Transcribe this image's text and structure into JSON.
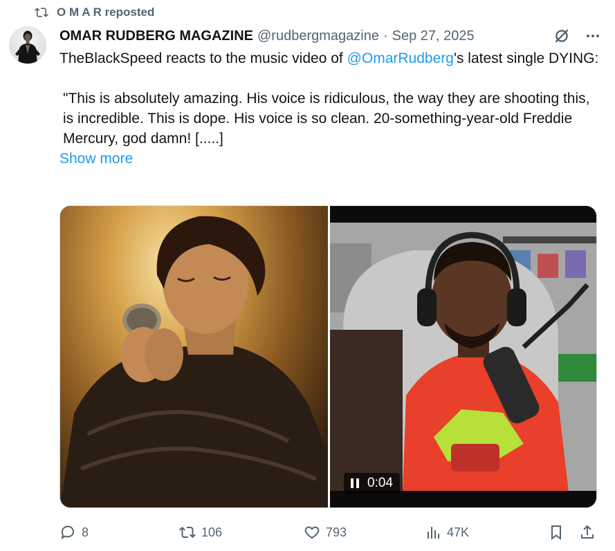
{
  "repost": {
    "text": "O M A R reposted",
    "icon": "repost-icon"
  },
  "author": {
    "name": "OMAR RUDBERG MAGAZINE",
    "handle": "@rudbergmagazine",
    "separator": "·",
    "date": "Sep 27, 2025"
  },
  "header_icons": [
    "grok-icon",
    "more-icon"
  ],
  "post": {
    "line1_before": "TheBlackSpeed reacts to the music video of ",
    "mention": "@OmarRudberg",
    "line1_after": "'s latest single DYING:",
    "quote": "\"This is absolutely amazing. His voice is ridiculous, the way they are shooting this, is incredible. This is dope. His voice is so clean. 20-something-year-old Freddie Mercury, god damn! [.....]",
    "show_more": "Show more"
  },
  "media": {
    "video_time": "0:04"
  },
  "actions": {
    "replies": "8",
    "reposts": "106",
    "likes": "793",
    "views": "47K"
  },
  "colors": {
    "link": "#1d9bf0",
    "muted": "#536471",
    "text": "#0f1419"
  }
}
